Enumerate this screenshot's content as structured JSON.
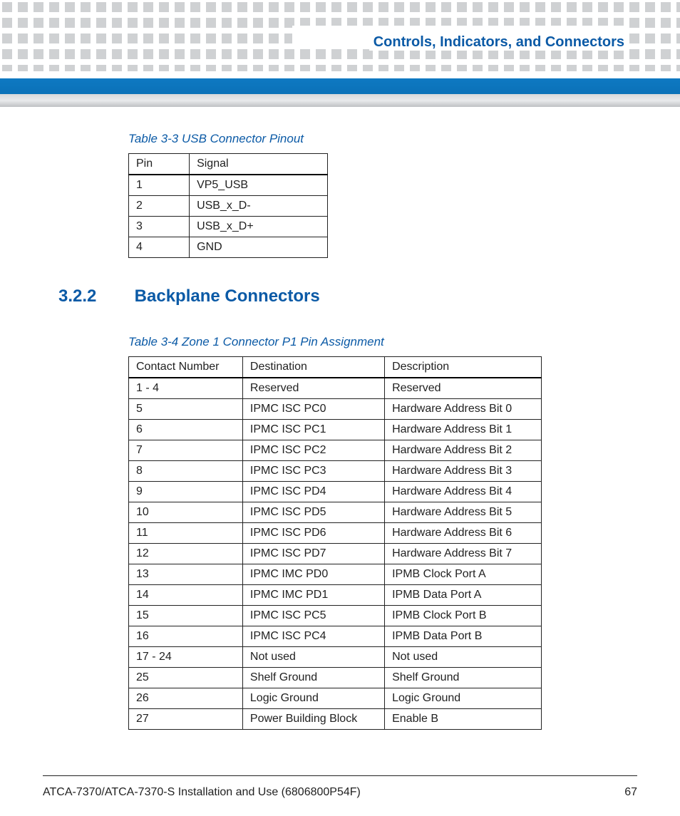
{
  "header": {
    "chapter_title": "Controls, Indicators, and Connectors"
  },
  "table1": {
    "caption": "Table 3-3 USB Connector Pinout",
    "headers": [
      "Pin",
      "Signal"
    ],
    "rows": [
      [
        "1",
        "VP5_USB"
      ],
      [
        "2",
        "USB_x_D-"
      ],
      [
        "3",
        "USB_x_D+"
      ],
      [
        "4",
        "GND"
      ]
    ]
  },
  "section": {
    "number": "3.2.2",
    "title": "Backplane Connectors"
  },
  "table2": {
    "caption": "Table 3-4 Zone 1 Connector P1 Pin Assignment",
    "headers": [
      "Contact Number",
      "Destination",
      "Description"
    ],
    "rows": [
      [
        "1 - 4",
        "Reserved",
        "Reserved"
      ],
      [
        "5",
        "IPMC ISC PC0",
        "Hardware Address Bit 0"
      ],
      [
        "6",
        "IPMC ISC PC1",
        "Hardware Address Bit 1"
      ],
      [
        "7",
        "IPMC ISC PC2",
        "Hardware Address Bit 2"
      ],
      [
        "8",
        "IPMC ISC PC3",
        "Hardware Address Bit 3"
      ],
      [
        "9",
        "IPMC ISC PD4",
        "Hardware Address Bit 4"
      ],
      [
        "10",
        "IPMC ISC PD5",
        "Hardware Address Bit 5"
      ],
      [
        "11",
        "IPMC ISC PD6",
        "Hardware Address Bit 6"
      ],
      [
        "12",
        "IPMC ISC PD7",
        "Hardware Address Bit 7"
      ],
      [
        "13",
        "IPMC IMC PD0",
        "IPMB Clock Port A"
      ],
      [
        "14",
        "IPMC IMC PD1",
        "IPMB Data Port A"
      ],
      [
        "15",
        "IPMC ISC PC5",
        "IPMB Clock Port B"
      ],
      [
        "16",
        "IPMC ISC PC4",
        "IPMB Data Port B"
      ],
      [
        "17 - 24",
        "Not used",
        "Not used"
      ],
      [
        "25",
        "Shelf Ground",
        "Shelf Ground"
      ],
      [
        "26",
        "Logic Ground",
        "Logic Ground"
      ],
      [
        "27",
        "Power Building Block",
        "Enable B"
      ]
    ]
  },
  "footer": {
    "left": "ATCA-7370/ATCA-7370-S Installation and Use (6806800P54F)",
    "right": "67"
  }
}
